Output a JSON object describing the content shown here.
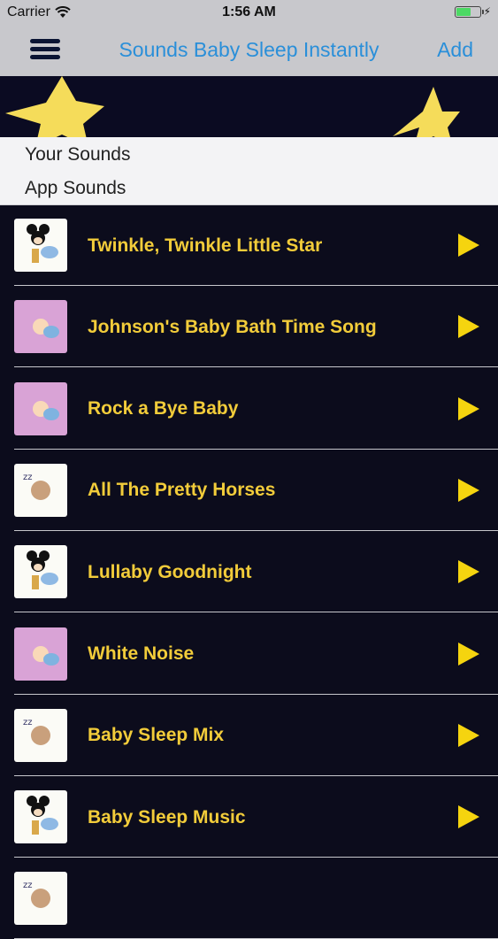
{
  "status_bar": {
    "carrier": "Carrier",
    "time": "1:56 AM",
    "wifi_icon": "wifi-icon",
    "battery_icon": "battery-icon"
  },
  "nav": {
    "title": "Sounds Baby Sleep Instantly",
    "add_label": "Add",
    "menu_icon": "hamburger-menu-icon",
    "title_color": "#2a8fd9"
  },
  "segments": {
    "items": [
      "Your Sounds",
      "App Sounds"
    ]
  },
  "colors": {
    "list_background": "#0c0c1c",
    "title_color": "#f2cc3a",
    "play_color": "#f5d40f",
    "star_color": "#f5dc5a"
  },
  "sounds": [
    {
      "title": "Twinkle, Twinkle Little Star",
      "thumb": "mouse-moon"
    },
    {
      "title": "Johnson's Baby Bath Time Song",
      "thumb": "baby-moon-pink"
    },
    {
      "title": "Rock a Bye Baby",
      "thumb": "baby-moon-pink"
    },
    {
      "title": "All The Pretty Horses",
      "thumb": "sleeping-baby-moon"
    },
    {
      "title": "Lullaby Goodnight",
      "thumb": "mouse-moon"
    },
    {
      "title": "White Noise",
      "thumb": "baby-moon-pink"
    },
    {
      "title": "Baby Sleep Mix",
      "thumb": "sleeping-baby-moon"
    },
    {
      "title": "Baby Sleep Music",
      "thumb": "mouse-moon"
    },
    {
      "title": "",
      "thumb": "sleeping-baby-moon"
    }
  ]
}
